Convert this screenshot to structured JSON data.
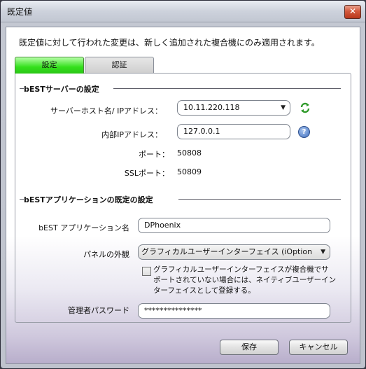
{
  "window": {
    "title": "既定値",
    "close_glyph": "✕"
  },
  "notice": "既定値に対して行われた変更は、新しく追加された複合機にのみ適用されます。",
  "tabs": [
    {
      "label": "設定",
      "active": true
    },
    {
      "label": "認証",
      "active": false
    }
  ],
  "server_section": {
    "title": "bESTサーバーの設定",
    "host_label": "サーバーホスト名/ IPアドレス：",
    "host_value": "10.11.220.118",
    "internal_ip_label": "内部IPアドレス：",
    "internal_ip_value": "127.0.0.1",
    "port_label": "ポート：",
    "port_value": "50808",
    "ssl_port_label": "SSLポート：",
    "ssl_port_value": "50809"
  },
  "app_section": {
    "title": "bESTアプリケーションの既定の設定",
    "app_name_label": "bEST アプリケーション名",
    "app_name_value": "DPhoenix",
    "panel_look_label": "パネルの外観",
    "panel_look_value": "グラフィカルユーザーインターフェイス (iOption",
    "checkbox_text_1": "グラフィカルユーザーインターフェイスが複合機でサ",
    "checkbox_text_2": "ポートされていない場合には、ネイティブユーザーイン",
    "checkbox_text_3": "ターフェイスとして登録する。",
    "checkbox_checked": false,
    "admin_password_label": "管理者パスワード",
    "admin_password_value": "***************"
  },
  "buttons": {
    "save": "保存",
    "cancel": "キャンセル"
  },
  "icons": {
    "refresh": "refresh-icon",
    "help": "help-icon",
    "close": "close-icon",
    "dropdown": "chevron-down-icon"
  },
  "colors": {
    "active_tab": "#34e01c",
    "help_icon": "#3f6fc0",
    "close_button": "#d2593c"
  }
}
